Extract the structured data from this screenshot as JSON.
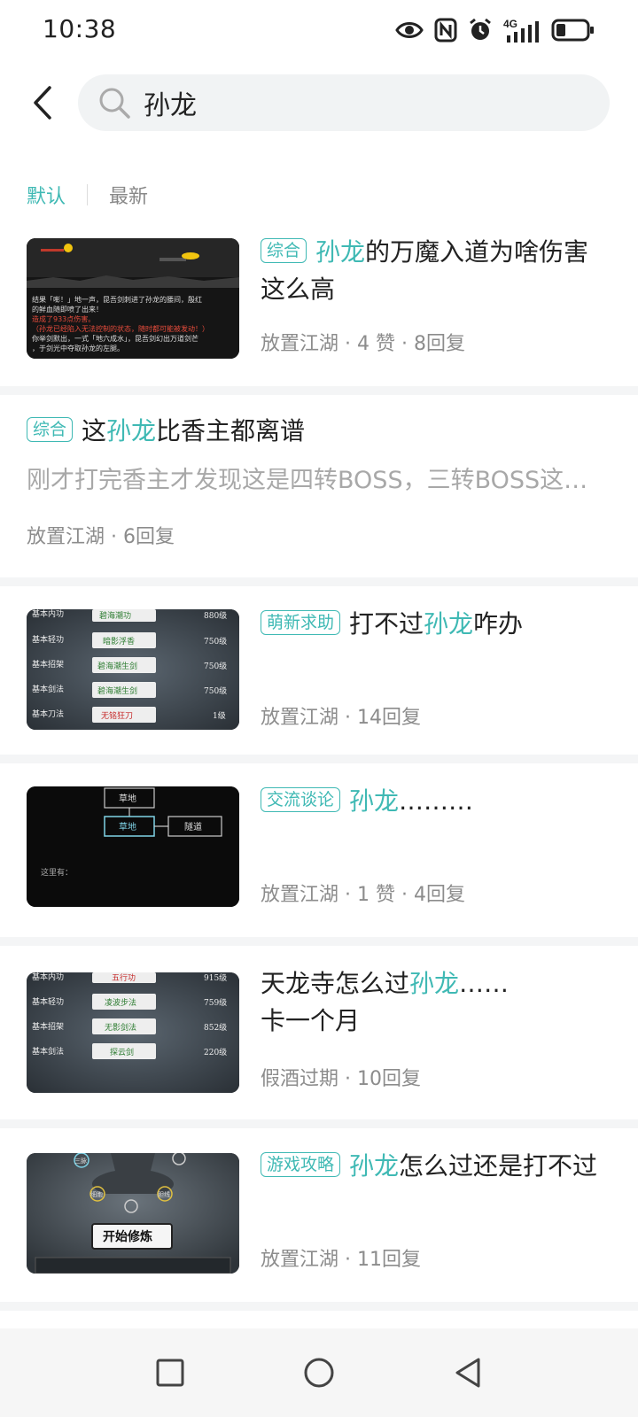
{
  "status_bar": {
    "time": "10:38",
    "network": "4G",
    "icons": [
      "eye-icon",
      "nfc-icon",
      "alarm-icon",
      "signal-icon",
      "battery-icon"
    ]
  },
  "search": {
    "query": "孙龙",
    "placeholder": ""
  },
  "sort_tabs": [
    {
      "label": "默认",
      "active": true
    },
    {
      "label": "最新",
      "active": false
    }
  ],
  "colors": {
    "accent": "#3fb9b4",
    "text": "#222222",
    "meta": "#8c8c8c"
  },
  "posts": [
    {
      "tag": "综合",
      "title_pre": "",
      "title_hl": "孙龙",
      "title_post": "的万魔入道为啥伤害这么高",
      "author": "放置江湖",
      "likes": "4 赞",
      "replies": "8回复",
      "thumb_lines": [
        "结果「嘭！」地一声，昆吾剑刺进了孙龙的腰间，殷红",
        "的鲜血随即喷了出来！",
        "造成了933点伤害。",
        "（孙龙已经陷入无法控制的状态，随时都可能被发动！）",
        "你举剑默出，一式「地六成水」，昆吾剑幻出万道剑芒",
        "，于剑光中夺取孙龙的左腿。"
      ]
    },
    {
      "tag": "综合",
      "title_pre": "这",
      "title_hl": "孙龙",
      "title_post": "比香主都离谱",
      "desc": "刚才打完香主才发现这是四转BOSS，三转BOSS这么高",
      "author": "放置江湖",
      "replies": "6回复"
    },
    {
      "tag": "萌新求助",
      "title_pre": "打不过",
      "title_hl": "孙龙",
      "title_post": "咋办",
      "author": "放置江湖",
      "replies": "14回复",
      "thumb_rows": [
        {
          "label": "基本内功",
          "skill": "碧海潮功",
          "level": "880级"
        },
        {
          "label": "基本轻功",
          "skill": "暗影浮香",
          "level": "750级"
        },
        {
          "label": "基本招架",
          "skill": "碧海潮生剑",
          "level": "750级"
        },
        {
          "label": "基本剑法",
          "skill": "碧海潮生剑",
          "level": "750级"
        },
        {
          "label": "基本刀法",
          "skill": "无铭狂刀",
          "level": "1级"
        }
      ]
    },
    {
      "tag": "交流谈论",
      "title_pre": "",
      "title_hl": "孙龙",
      "title_post": "………",
      "author": "放置江湖",
      "likes": "1 赞",
      "replies": "4回复",
      "thumb_map": {
        "top": "草地",
        "center": "草地",
        "right": "隧道",
        "footer": "这里有："
      }
    },
    {
      "title_pre": "天龙寺怎么过",
      "title_hl": "孙龙",
      "title_post": "……",
      "title_line2": "卡一个月",
      "author": "假酒过期",
      "replies": "10回复",
      "thumb_rows": [
        {
          "label": "基本内功",
          "skill": "五行功",
          "level": "915级"
        },
        {
          "label": "基本轻功",
          "skill": "凌波步法",
          "level": "759级"
        },
        {
          "label": "基本招架",
          "skill": "无影剑法",
          "level": "852级"
        },
        {
          "label": "基本剑法",
          "skill": "探云剑",
          "level": "220级"
        }
      ]
    },
    {
      "tag": "游戏攻略",
      "title_pre": "",
      "title_hl": "孙龙",
      "title_post": "怎么过还是打不过",
      "author": "放置江湖",
      "replies": "11回复",
      "thumb_button": "开始修炼",
      "thumb_nodes": [
        "三脉",
        "细胞",
        "胆线"
      ]
    }
  ],
  "nav": [
    "square-icon",
    "circle-icon",
    "triangle-back-icon"
  ]
}
